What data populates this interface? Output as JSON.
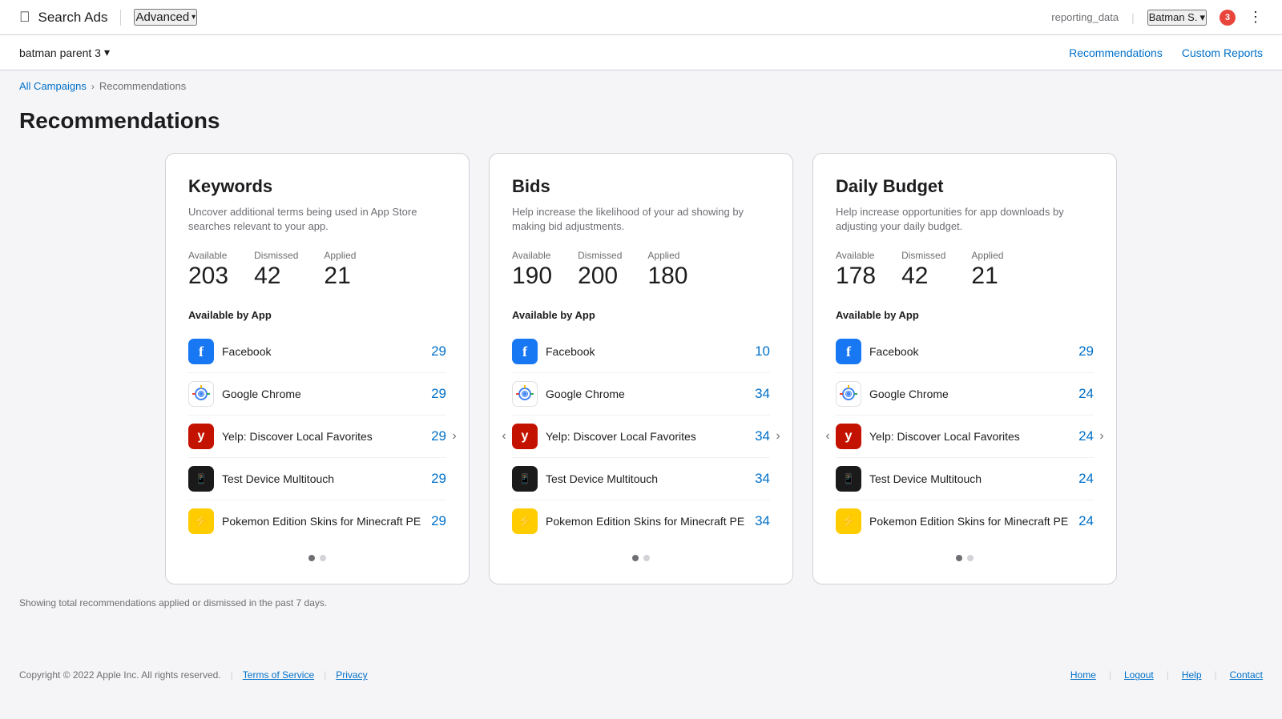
{
  "header": {
    "apple_logo": "🍎",
    "brand": "Search Ads",
    "advanced_label": "Advanced",
    "user_data_label": "reporting_data",
    "user_name": "Batman S.",
    "notification_count": "3"
  },
  "sub_header": {
    "org_name": "batman parent 3",
    "nav": [
      {
        "label": "Recommendations",
        "id": "recommendations"
      },
      {
        "label": "Custom Reports",
        "id": "custom-reports"
      }
    ]
  },
  "breadcrumb": {
    "parent": "All Campaigns",
    "current": "Recommendations"
  },
  "page_title": "Recommendations",
  "cards": [
    {
      "id": "keywords",
      "title": "Keywords",
      "description": "Uncover additional terms being used in App Store searches relevant to your app.",
      "stats": {
        "available_label": "Available",
        "available_value": "203",
        "dismissed_label": "Dismissed",
        "dismissed_value": "42",
        "applied_label": "Applied",
        "applied_value": "21"
      },
      "section_label": "Available by App",
      "apps": [
        {
          "name": "Facebook",
          "count": "29",
          "icon_type": "facebook"
        },
        {
          "name": "Google Chrome",
          "count": "29",
          "icon_type": "chrome"
        },
        {
          "name": "Yelp: Discover Local Favorites",
          "count": "29",
          "icon_type": "yelp"
        },
        {
          "name": "Test Device Multitouch",
          "count": "29",
          "icon_type": "testdev"
        },
        {
          "name": "Pokemon Edition Skins for Minecraft PE",
          "count": "29",
          "icon_type": "pokemon"
        }
      ],
      "has_left_arrow": false,
      "has_right_arrow": true,
      "dots": [
        true,
        false
      ]
    },
    {
      "id": "bids",
      "title": "Bids",
      "description": "Help increase the likelihood of your ad showing by making bid adjustments.",
      "stats": {
        "available_label": "Available",
        "available_value": "190",
        "dismissed_label": "Dismissed",
        "dismissed_value": "200",
        "applied_label": "Applied",
        "applied_value": "180"
      },
      "section_label": "Available by App",
      "apps": [
        {
          "name": "Facebook",
          "count": "10",
          "icon_type": "facebook"
        },
        {
          "name": "Google Chrome",
          "count": "34",
          "icon_type": "chrome"
        },
        {
          "name": "Yelp: Discover Local Favorites",
          "count": "34",
          "icon_type": "yelp"
        },
        {
          "name": "Test Device Multitouch",
          "count": "34",
          "icon_type": "testdev"
        },
        {
          "name": "Pokemon Edition Skins for Minecraft PE",
          "count": "34",
          "icon_type": "pokemon"
        }
      ],
      "has_left_arrow": true,
      "has_right_arrow": true,
      "dots": [
        true,
        false
      ]
    },
    {
      "id": "daily-budget",
      "title": "Daily Budget",
      "description": "Help increase opportunities for app downloads by adjusting your daily budget.",
      "stats": {
        "available_label": "Available",
        "available_value": "178",
        "dismissed_label": "Dismissed",
        "dismissed_value": "42",
        "applied_label": "Applied",
        "applied_value": "21"
      },
      "section_label": "Available by App",
      "apps": [
        {
          "name": "Facebook",
          "count": "29",
          "icon_type": "facebook"
        },
        {
          "name": "Google Chrome",
          "count": "24",
          "icon_type": "chrome"
        },
        {
          "name": "Yelp: Discover Local Favorites",
          "count": "24",
          "icon_type": "yelp"
        },
        {
          "name": "Test Device Multitouch",
          "count": "24",
          "icon_type": "testdev"
        },
        {
          "name": "Pokemon Edition Skins for Minecraft PE",
          "count": "24",
          "icon_type": "pokemon"
        }
      ],
      "has_left_arrow": true,
      "has_right_arrow": true,
      "dots": [
        true,
        false
      ]
    }
  ],
  "footer_note": "Showing total recommendations applied or dismissed in the past 7 days.",
  "page_footer": {
    "copyright": "Copyright © 2022 Apple Inc. All rights reserved.",
    "links": [
      "Terms of Service",
      "Privacy"
    ],
    "right_links": [
      "Home",
      "Logout",
      "Help",
      "Contact"
    ]
  }
}
